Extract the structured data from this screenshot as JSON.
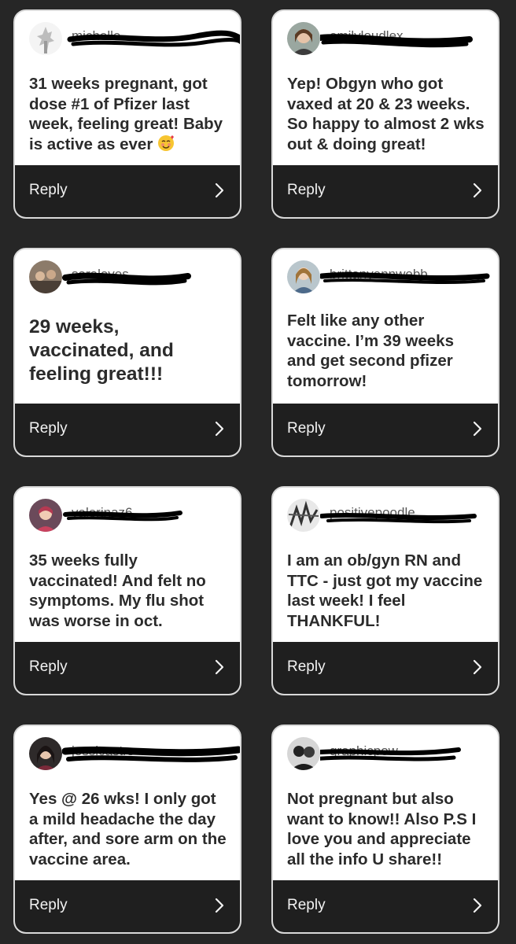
{
  "cards": [
    {
      "username": "michelle",
      "comment": "31 weeks pregnant, got dose #1 of Pfizer last week, feeling great! Baby is active as ever",
      "emoji": "smiling-face-with-hearts-icon",
      "reply_label": "Reply"
    },
    {
      "username": "emilyloudlex",
      "comment": "Yep! Obgyn who got vaxed at 20 & 23 weeks. So happy to almost 2 wks out & doing great!",
      "reply_label": "Reply"
    },
    {
      "username": "saraloves",
      "comment": "29 weeks, vaccinated, and feeling great!!!",
      "reply_label": "Reply"
    },
    {
      "username": "brittanyannwebb",
      "comment": "Felt like any other vaccine. I’m 39 weeks and get second pfizer tomorrow!",
      "reply_label": "Reply"
    },
    {
      "username": "valerinaz6",
      "comment": "35 weeks fully vaccinated! And felt no symptoms. My flu shot was worse in oct.",
      "reply_label": "Reply"
    },
    {
      "username": "positivepoodle",
      "comment": "I am an ob/gyn RN and TTC - just got my vaccine last week! I feel THANKFUL!",
      "reply_label": "Reply"
    },
    {
      "username": "jessicastrs",
      "comment": "Yes @ 26 wks! I only got a mild headache the day after, and sore arm on the vaccine area.",
      "reply_label": "Reply"
    },
    {
      "username": "graphicpow",
      "comment": "Not pregnant but also want to know!! Also P.S I love you and appreciate all the info U share!!",
      "reply_label": "Reply"
    }
  ],
  "colors": {
    "background": "#262626",
    "card": "#ffffff",
    "reply_bar": "#1f1f1f",
    "text": "#2b2b2b",
    "reply_text": "#f2f2f2"
  }
}
